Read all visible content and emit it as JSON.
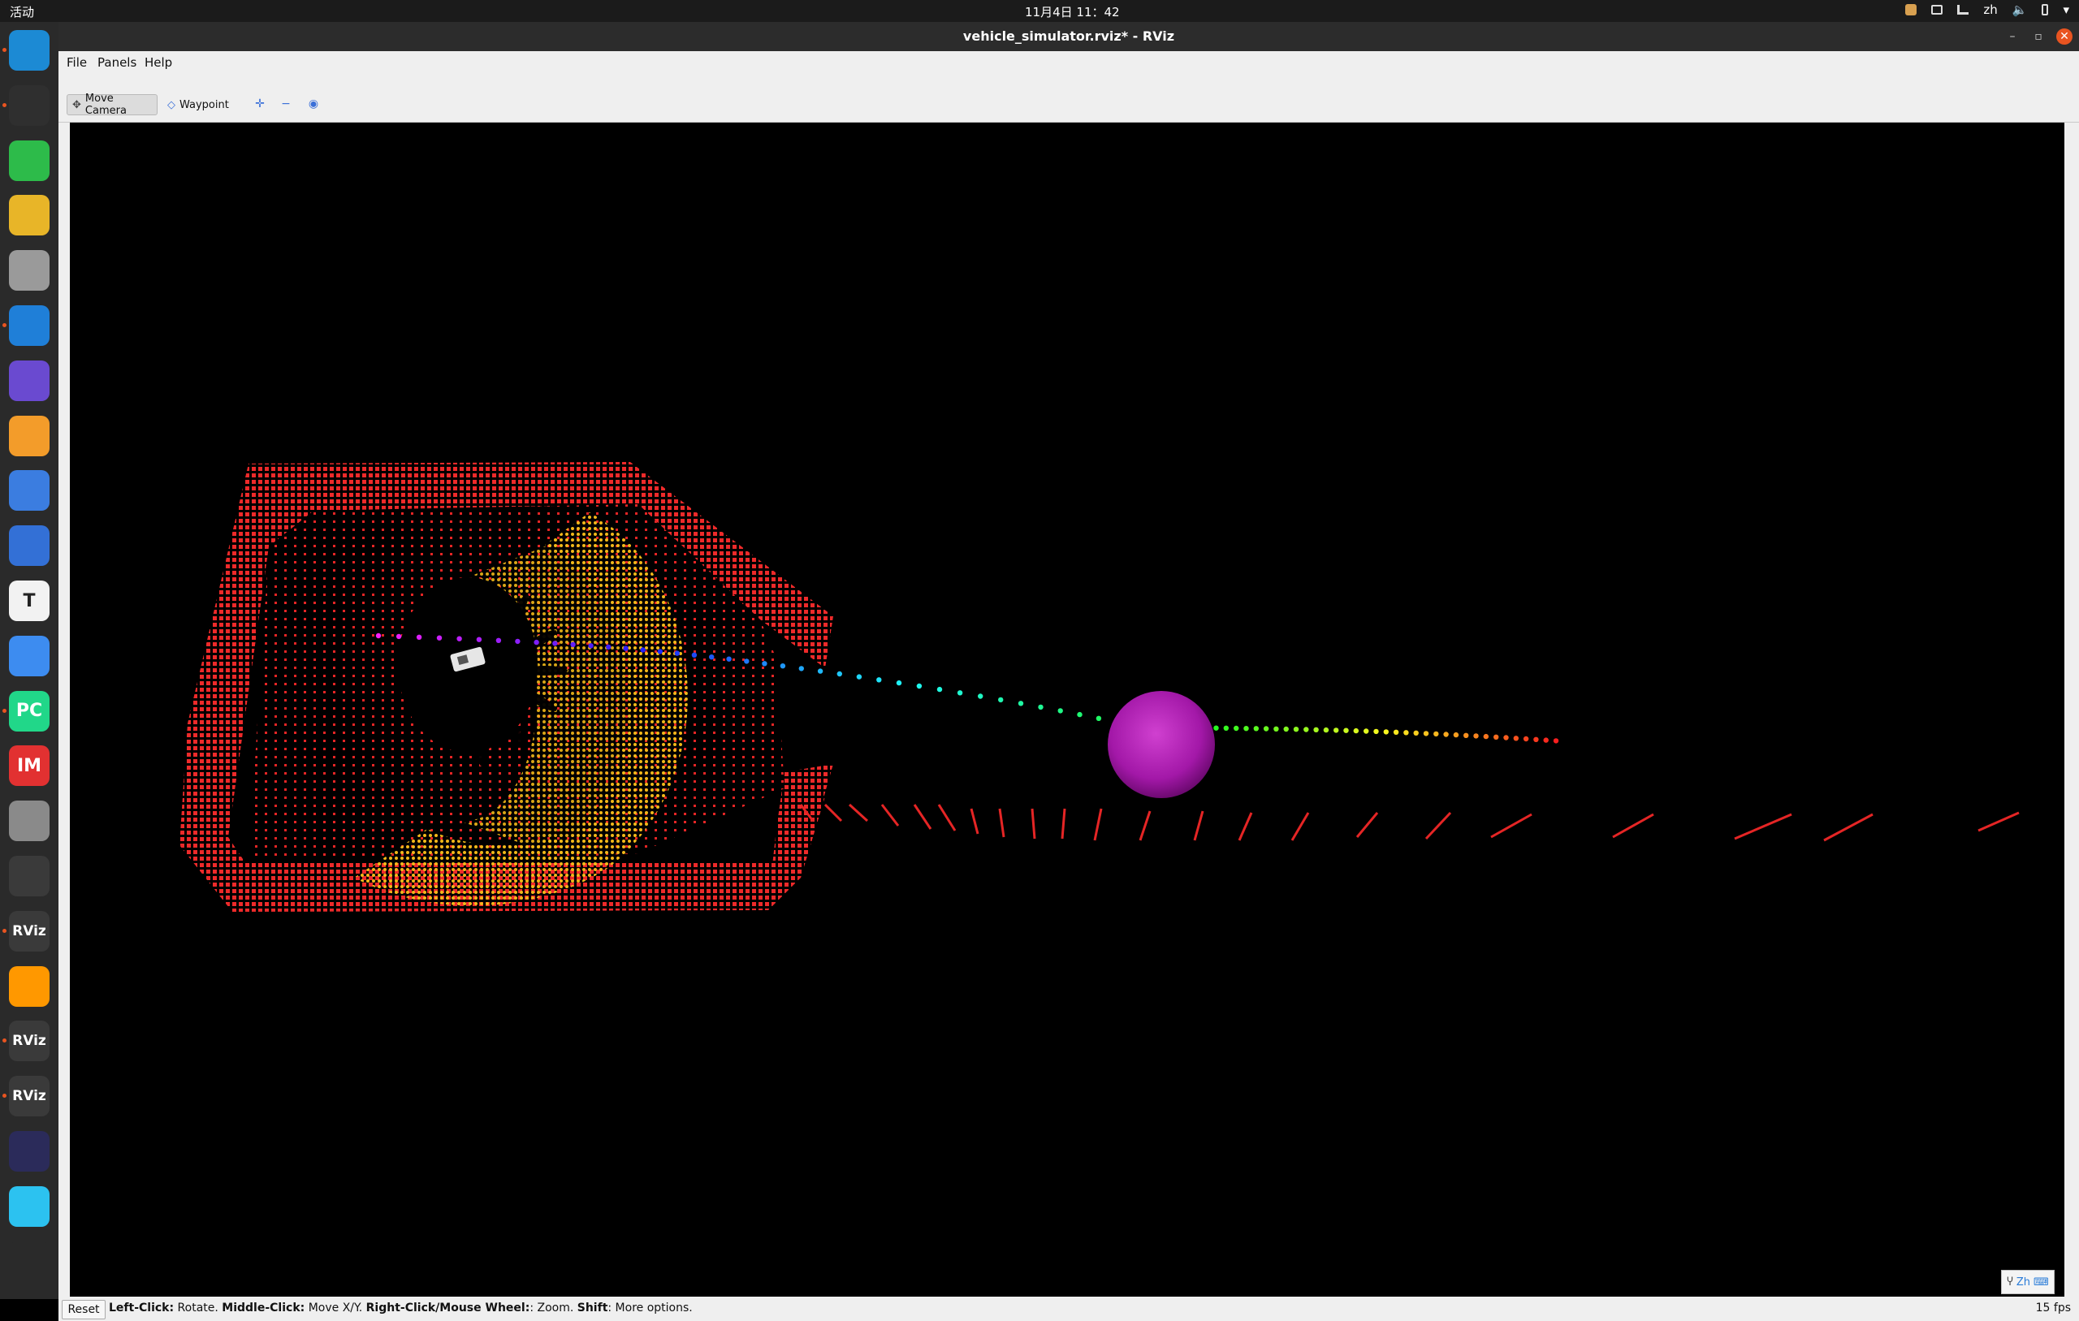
{
  "topbar": {
    "activities": "活动",
    "clock": "11月4日  11：42",
    "lang": "zh"
  },
  "window": {
    "title": "vehicle_simulator.rviz* - RViz"
  },
  "menu": {
    "file": "File",
    "panels": "Panels",
    "help": "Help"
  },
  "toolbar": {
    "move_camera": "Move Camera",
    "waypoint": "Waypoint"
  },
  "status": {
    "reset": "Reset",
    "left_click": "Left-Click:",
    "left_click_action": " Rotate. ",
    "middle_click": "Middle-Click:",
    "middle_click_action": " Move X/Y. ",
    "right_click": "Right-Click/Mouse Wheel:",
    "right_click_action": ": Zoom. ",
    "shift": "Shift",
    "shift_action": ": More options.",
    "fps": "15 fps"
  },
  "ime": {
    "label": "Zh"
  },
  "dock": [
    {
      "name": "edge-dev-icon",
      "color": "#1c8ad4",
      "running": true
    },
    {
      "name": "terminal-icon",
      "color": "#2f2f2f",
      "running": true
    },
    {
      "name": "wechat-icon",
      "color": "#2dbb4a",
      "running": false
    },
    {
      "name": "rhythmbox-icon",
      "color": "#e8b528",
      "running": false
    },
    {
      "name": "files-icon",
      "color": "#9a9a9a",
      "running": false
    },
    {
      "name": "vscode-icon",
      "color": "#1f7fd8",
      "running": true
    },
    {
      "name": "screen-recorder-icon",
      "color": "#6a4ad0",
      "running": false
    },
    {
      "name": "brightness-icon",
      "color": "#f39c2a",
      "running": false
    },
    {
      "name": "screenshot-icon",
      "color": "#3b7de0",
      "running": false
    },
    {
      "name": "writer-icon",
      "color": "#3370d6",
      "running": false
    },
    {
      "name": "text-editor-icon",
      "color": "#f2f2f2",
      "running": false
    },
    {
      "name": "baidu-netdisk-icon",
      "color": "#3d8cf0",
      "running": false
    },
    {
      "name": "pycharm-icon",
      "color": "#21d789",
      "running": true
    },
    {
      "name": "im-icon",
      "color": "#e23131",
      "running": false
    },
    {
      "name": "settings-icon",
      "color": "#8a8a8a",
      "running": false
    },
    {
      "name": "night-light-icon",
      "color": "#3a3a3a",
      "running": false
    },
    {
      "name": "rviz-icon-1",
      "color": "#3a3a3a",
      "running": true
    },
    {
      "name": "sublime-icon",
      "color": "#ff9800",
      "running": false
    },
    {
      "name": "rviz-icon-2",
      "color": "#3a3a3a",
      "running": true
    },
    {
      "name": "rviz-icon-3",
      "color": "#3a3a3a",
      "running": true
    },
    {
      "name": "app-cat-icon",
      "color": "#2b2b5a",
      "running": false
    },
    {
      "name": "feishu-icon",
      "color": "#2cc2f0",
      "running": false
    },
    {
      "name": "show-apps-icon",
      "color": "#2a2a2a",
      "running": false
    }
  ],
  "dock_labels": {
    "rviz": "RViz",
    "pycharm": "PC",
    "text": "T",
    "im": "IM"
  }
}
